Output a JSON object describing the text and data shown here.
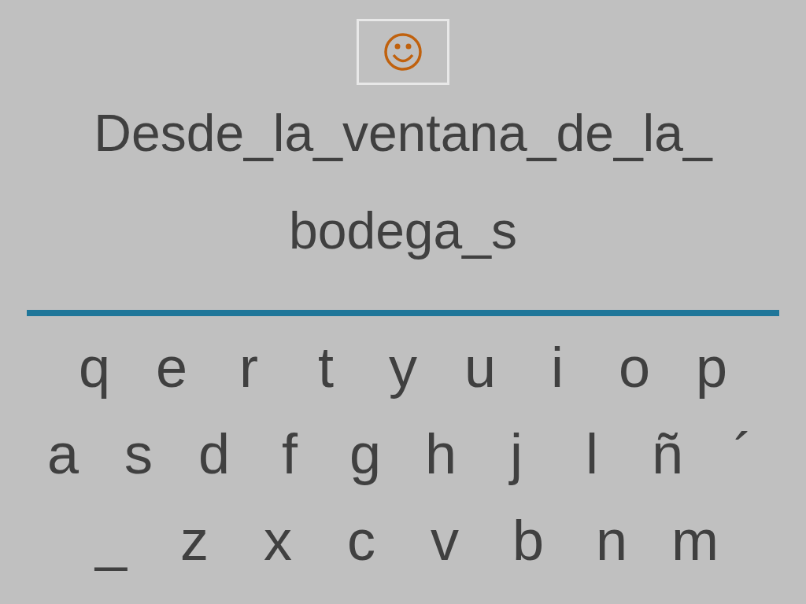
{
  "feedback": {
    "kind": "smiley"
  },
  "sentence_lines": [
    "Desde_la_ventana_de_la_",
    "bodega_s"
  ],
  "keyboard_rows": [
    {
      "keys": [
        "q",
        "e",
        "r",
        "t",
        "y",
        "u",
        "i",
        "o",
        "p"
      ]
    },
    {
      "keys": [
        "a",
        "s",
        "d",
        "f",
        "g",
        "h",
        "j",
        "l",
        "ñ",
        "´"
      ]
    },
    {
      "keys": [
        "_",
        "z",
        "x",
        "c",
        "v",
        "b",
        "n",
        "m"
      ]
    }
  ]
}
